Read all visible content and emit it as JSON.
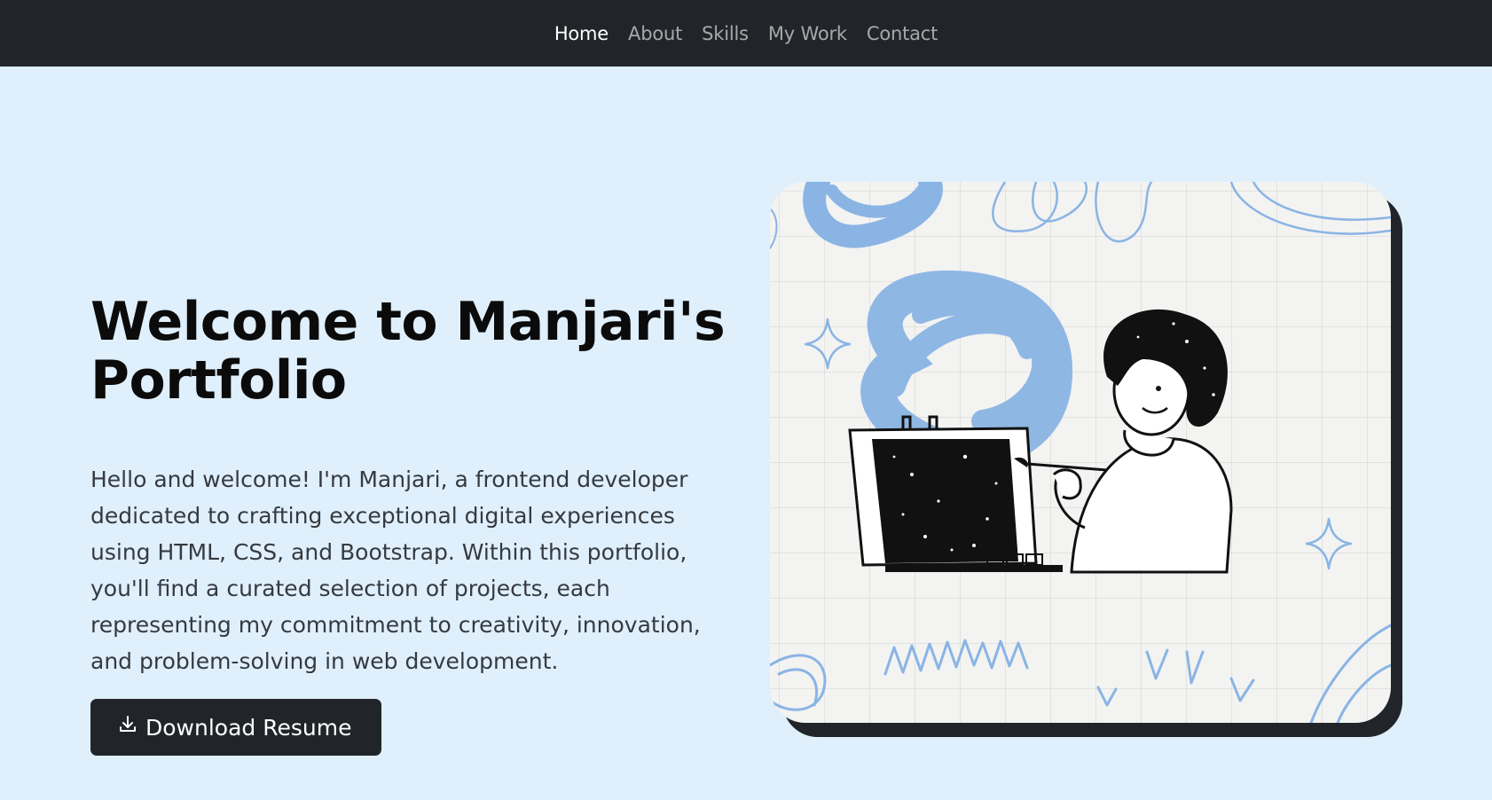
{
  "nav": {
    "items": [
      {
        "label": "Home",
        "active": true
      },
      {
        "label": "About",
        "active": false
      },
      {
        "label": "Skills",
        "active": false
      },
      {
        "label": "My Work",
        "active": false
      },
      {
        "label": "Contact",
        "active": false
      }
    ]
  },
  "hero": {
    "title": "Welcome to Manjari's Portfolio",
    "description": "Hello and welcome! I'm Manjari, a frontend developer dedicated to crafting exceptional digital experiences using HTML, CSS, and Bootstrap. Within this portfolio, you'll find a curated selection of projects, each representing my commitment to creativity, innovation, and problem-solving in web development.",
    "button_label": "Download Resume",
    "button_icon": "download-icon"
  },
  "illustration": {
    "icon": "artist-painting-illustration"
  },
  "colors": {
    "navbar_bg": "#212529",
    "page_bg": "#dfeffc",
    "accent_blue": "#8ab4e4",
    "button_bg": "#212529"
  }
}
